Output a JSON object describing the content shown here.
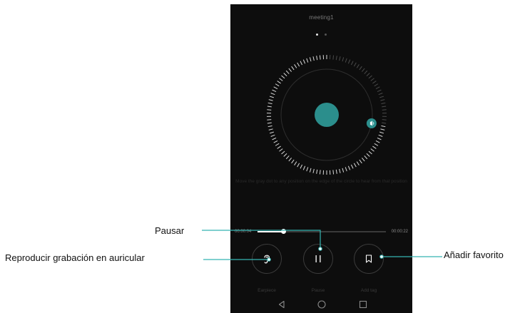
{
  "recording": {
    "title": "meeting1"
  },
  "pager": {
    "count": 2,
    "active": 0
  },
  "dial": {
    "hint": "Move the gray dot to any position on the edge of the circle to hear from that position",
    "playhead_fraction": 0.72,
    "accent": "#2b8e8c"
  },
  "progress": {
    "elapsed": "00:00:04",
    "total": "00:00:22",
    "fraction": 0.2
  },
  "controls": {
    "earpiece_label": "Earpiece",
    "pause_label": "Pause",
    "tag_label": "Add tag"
  },
  "navbar": {
    "back": "back-icon",
    "home": "home-icon",
    "recent": "recent-apps-icon"
  },
  "callouts": {
    "pause": "Pausar",
    "earpiece": "Reproducir grabación en auricular",
    "tag": "Añadir favorito"
  },
  "colors": {
    "accent": "#2b8e8c",
    "callout_line": "#35b5b2",
    "screen_bg": "#0d0d0d"
  }
}
